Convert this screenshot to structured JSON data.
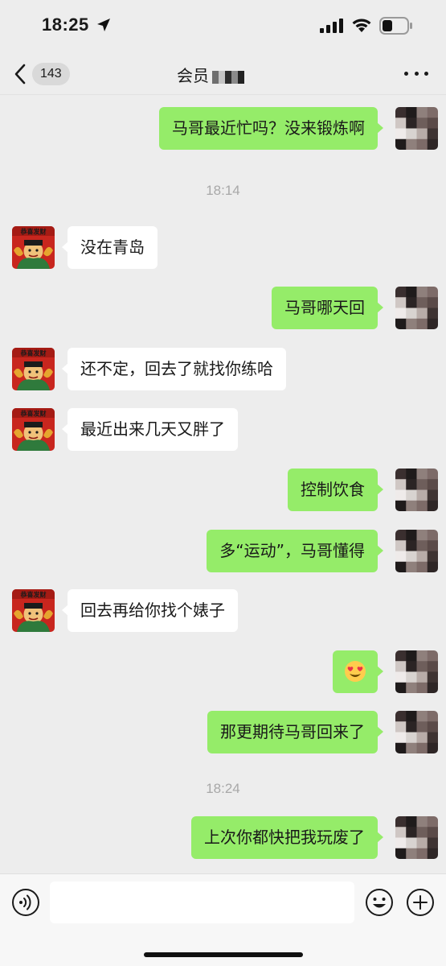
{
  "status_bar": {
    "time": "18:25",
    "icons": [
      "location-arrow-icon",
      "cellular-signal-icon",
      "wifi-icon",
      "battery-icon"
    ]
  },
  "nav": {
    "unread_count": "143",
    "title": "会员",
    "icons": [
      "chevron-left-icon",
      "more-icon"
    ]
  },
  "messages": [
    {
      "from": "me",
      "text": "马哥最近忙吗？没来锻炼啊"
    },
    {
      "type": "time",
      "text": "18:14"
    },
    {
      "from": "contact",
      "text": "没在青岛"
    },
    {
      "from": "me",
      "text": "马哥哪天回"
    },
    {
      "from": "contact",
      "text": "还不定，回去了就找你练哈"
    },
    {
      "from": "contact",
      "text": "最近出来几天又胖了"
    },
    {
      "from": "me",
      "text": "控制饮食"
    },
    {
      "from": "me",
      "text": "多“运动”，马哥懂得"
    },
    {
      "from": "contact",
      "text": "回去再给你找个婊子"
    },
    {
      "from": "me",
      "text": "",
      "emoji": "heart-eyes-emoji"
    },
    {
      "from": "me",
      "text": "那更期待马哥回来了"
    },
    {
      "type": "time",
      "text": "18:24"
    },
    {
      "from": "me",
      "text": "上次你都快把我玩废了"
    }
  ],
  "input_bar": {
    "placeholder": "",
    "icons": [
      "voice-icon",
      "emoji-icon",
      "plus-icon"
    ]
  },
  "avatar_text": "恭喜发财",
  "colors": {
    "background": "#ededed",
    "my_bubble": "#95ec69",
    "their_bubble": "#ffffff",
    "timestamp": "#a8a8a8"
  }
}
